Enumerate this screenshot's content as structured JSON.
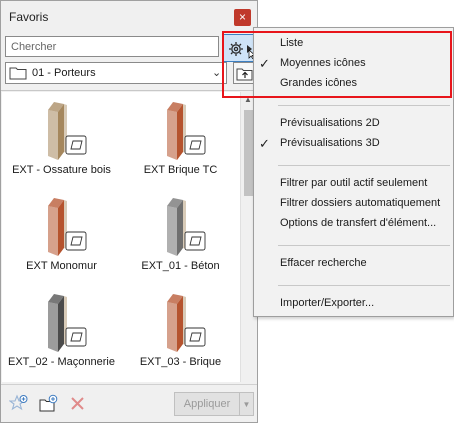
{
  "palette": {
    "title": "Favoris",
    "close_glyph": "×",
    "search_placeholder": "Chercher",
    "folder": {
      "label": "01 - Porteurs"
    },
    "items": [
      {
        "label": "EXT - Ossature bois",
        "material": "wood"
      },
      {
        "label": "EXT Brique TC",
        "material": "brick"
      },
      {
        "label": "EXT Monomur",
        "material": "brick"
      },
      {
        "label": "EXT_01 - Béton",
        "material": "concrete"
      },
      {
        "label": "EXT_02 - Maçonnerie",
        "material": "masonry"
      },
      {
        "label": "EXT_03 - Brique",
        "material": "brick"
      }
    ],
    "apply_label": "Appliquer"
  },
  "menu": {
    "items": [
      {
        "label": "Liste",
        "checked": false
      },
      {
        "label": "Moyennes icônes",
        "checked": true
      },
      {
        "label": "Grandes icônes",
        "checked": false
      },
      {
        "label": "Prévisualisations 2D",
        "checked": false
      },
      {
        "label": "Prévisualisations 3D",
        "checked": true
      },
      {
        "label": "Filtrer par outil actif seulement",
        "checked": false
      },
      {
        "label": "Filtrer dossiers automatiquement",
        "checked": false
      },
      {
        "label": "Options de transfert d'élément...",
        "checked": false
      },
      {
        "label": "Effacer recherche",
        "checked": false
      },
      {
        "label": "Importer/Exporter...",
        "checked": false
      }
    ],
    "check_glyph": "✓"
  },
  "colors": {
    "accent_red": "#e8151b",
    "selection_blue": "#cfe3f7",
    "wood": "#a5875d",
    "brick": "#b5532e",
    "concrete": "#6f6f6f",
    "masonry": "#4b4b4b"
  }
}
